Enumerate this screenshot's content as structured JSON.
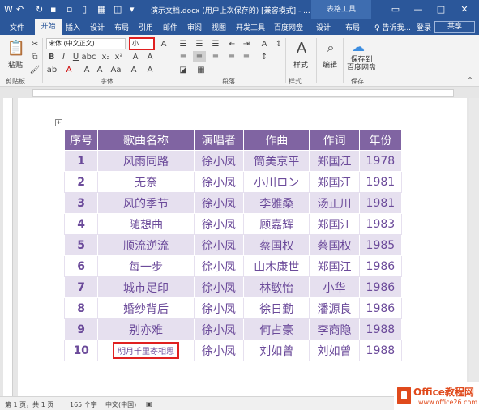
{
  "titlebar": {
    "document_title": "演示文档.docx (用户上次保存的) [兼容模式] - ...",
    "table_tools": "表格工具"
  },
  "tabs": [
    "文件",
    "开始",
    "插入",
    "设计",
    "布局",
    "引用",
    "邮件",
    "审阅",
    "视图",
    "开发工具",
    "百度网盘",
    "设计",
    "布局"
  ],
  "tell_me": "♀ 告诉我...",
  "login": "登录",
  "share": "共享",
  "ribbon": {
    "paste_label": "粘贴",
    "font_name": "宋体 (中文正文)",
    "font_size": "小二",
    "styles_label": "样式",
    "edit_label": "编辑",
    "save_label": "保存到\n百度网盘",
    "groups": {
      "clipboard": "剪贴板",
      "font": "字体",
      "paragraph": "段落",
      "styles": "样式",
      "save": "保存"
    }
  },
  "table": {
    "headers": [
      "序号",
      "歌曲名称",
      "演唱者",
      "作曲",
      "作词",
      "年份"
    ],
    "rows": [
      [
        "1",
        "风雨同路",
        "徐小凤",
        "筒美京平",
        "郑国江",
        "1978"
      ],
      [
        "2",
        "无奈",
        "徐小凤",
        "小川ロン",
        "郑国江",
        "1981"
      ],
      [
        "3",
        "风的季节",
        "徐小凤",
        "李雅桑",
        "汤正川",
        "1981"
      ],
      [
        "4",
        "随想曲",
        "徐小凤",
        "顾嘉辉",
        "郑国江",
        "1983"
      ],
      [
        "5",
        "顺流逆流",
        "徐小凤",
        "蔡国权",
        "蔡国权",
        "1985"
      ],
      [
        "6",
        "每一步",
        "徐小凤",
        "山木康世",
        "郑国江",
        "1986"
      ],
      [
        "7",
        "城市足印",
        "徐小凤",
        "林敏怡",
        "小华",
        "1986"
      ],
      [
        "8",
        "婚纱背后",
        "徐小凤",
        "徐日勤",
        "潘源良",
        "1986"
      ],
      [
        "9",
        "别亦难",
        "徐小凤",
        "何占豪",
        "李商隐",
        "1988"
      ],
      [
        "10",
        "明月千里寄相思",
        "徐小凤",
        "刘如曾",
        "刘如曾",
        "1988"
      ]
    ]
  },
  "status": {
    "pages": "第 1 页，共 1 页",
    "words": "165 个字",
    "lang": "中文(中国)"
  },
  "logo": {
    "title": "Office教程网",
    "url": "www.office26.com"
  },
  "colors": {
    "accent": "#2b579a",
    "table_header": "#8064a2",
    "table_stripe": "#e6e0ef",
    "table_text": "#6b4a9a",
    "highlight": "#e02020"
  }
}
